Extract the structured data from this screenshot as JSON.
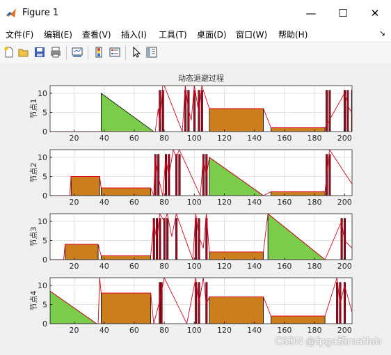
{
  "window": {
    "title": "Figure 1",
    "minimize": "—",
    "maximize": "☐",
    "close": "✕"
  },
  "menu": {
    "items": [
      "文件(F)",
      "编辑(E)",
      "查看(V)",
      "插入(I)",
      "工具(T)",
      "桌面(D)",
      "窗口(W)",
      "帮助(H)"
    ],
    "overflow": "↘"
  },
  "toolbar": {
    "buttons": [
      "new-figure-icon",
      "open-file-icon",
      "save-icon",
      "print-icon",
      "link-plot-icon",
      "insert-colorbar-icon",
      "insert-legend-icon",
      "edit-plot-icon",
      "property-inspector-icon"
    ]
  },
  "figure_title": "动态退避过程",
  "watermark": "CSDN @fpga和matlab",
  "colors": {
    "fill_triangle": "#7ccc4c",
    "fill_block": "#cc7e1c",
    "line": "#d8001c",
    "burst": "#b40018"
  },
  "chart_data": [
    {
      "type": "area",
      "ylabel": "节点1",
      "xlim": [
        4,
        205
      ],
      "ylim": [
        0,
        12
      ],
      "xticks": [
        20,
        40,
        60,
        80,
        100,
        120,
        140,
        160,
        180,
        200
      ],
      "yticks": [
        0,
        5,
        10
      ],
      "triangles": [
        {
          "x0": 38,
          "x1": 73,
          "y": 10
        }
      ],
      "blocks": [
        {
          "x0": 110,
          "x1": 146,
          "y": 6
        },
        {
          "x0": 151,
          "x1": 187,
          "y": 1
        }
      ],
      "bursts": [
        77,
        79,
        94,
        96,
        100,
        103,
        105,
        188,
        190,
        200,
        202,
        205
      ],
      "line": [
        [
          4,
          0
        ],
        [
          38,
          0
        ],
        [
          73,
          0
        ],
        [
          74,
          0
        ],
        [
          76,
          6
        ],
        [
          77,
          2
        ],
        [
          79,
          12
        ],
        [
          80,
          12
        ],
        [
          92,
          0
        ],
        [
          94,
          12
        ],
        [
          96,
          6
        ],
        [
          98,
          3
        ],
        [
          100,
          12
        ],
        [
          103,
          5
        ],
        [
          105,
          12
        ],
        [
          110,
          6
        ],
        [
          146,
          6
        ],
        [
          151,
          1
        ],
        [
          187,
          1
        ],
        [
          200,
          10
        ],
        [
          203,
          6
        ],
        [
          205,
          5
        ]
      ]
    },
    {
      "type": "area",
      "ylabel": "节点2",
      "xlim": [
        4,
        205
      ],
      "ylim": [
        0,
        12
      ],
      "xticks": [
        20,
        40,
        60,
        80,
        100,
        120,
        140,
        160,
        180,
        200
      ],
      "yticks": [
        0,
        5,
        10
      ],
      "triangles": [
        {
          "x0": 110,
          "x1": 146,
          "y": 10
        }
      ],
      "blocks": [
        {
          "x0": 18,
          "x1": 37,
          "y": 5
        },
        {
          "x0": 38,
          "x1": 71,
          "y": 2
        },
        {
          "x0": 151,
          "x1": 187,
          "y": 1
        }
      ],
      "bursts": [
        74,
        76,
        81,
        83,
        88,
        90,
        106,
        108,
        188,
        190
      ],
      "line": [
        [
          4,
          0
        ],
        [
          17,
          0
        ],
        [
          18,
          5
        ],
        [
          37,
          5
        ],
        [
          38,
          2
        ],
        [
          71,
          2
        ],
        [
          73,
          0
        ],
        [
          74,
          10
        ],
        [
          76,
          5
        ],
        [
          79,
          0
        ],
        [
          81,
          10
        ],
        [
          83,
          5
        ],
        [
          86,
          12
        ],
        [
          88,
          10
        ],
        [
          90,
          12
        ],
        [
          104,
          0
        ],
        [
          106,
          10
        ],
        [
          108,
          5
        ],
        [
          110,
          10
        ],
        [
          146,
          0
        ],
        [
          151,
          1
        ],
        [
          187,
          1
        ],
        [
          190,
          12
        ],
        [
          205,
          3
        ]
      ]
    },
    {
      "type": "area",
      "ylabel": "节点3",
      "xlim": [
        4,
        205
      ],
      "ylim": [
        0,
        12
      ],
      "xticks": [
        20,
        40,
        60,
        80,
        100,
        120,
        140,
        160,
        180,
        200
      ],
      "yticks": [
        0,
        5,
        10
      ],
      "triangles": [
        {
          "x0": 149,
          "x1": 187,
          "y": 12
        }
      ],
      "blocks": [
        {
          "x0": 14,
          "x1": 36,
          "y": 4
        },
        {
          "x0": 38,
          "x1": 71,
          "y": 1
        },
        {
          "x0": 110,
          "x1": 146,
          "y": 2
        }
      ],
      "bursts": [
        73,
        75,
        77,
        80,
        82,
        88,
        101,
        103,
        108,
        198,
        200
      ],
      "line": [
        [
          4,
          0
        ],
        [
          13,
          0
        ],
        [
          14,
          4
        ],
        [
          36,
          4
        ],
        [
          38,
          1
        ],
        [
          71,
          1
        ],
        [
          73,
          10
        ],
        [
          75,
          5
        ],
        [
          77,
          12
        ],
        [
          80,
          10
        ],
        [
          82,
          12
        ],
        [
          85,
          6
        ],
        [
          88,
          12
        ],
        [
          99,
          0
        ],
        [
          101,
          12
        ],
        [
          103,
          6
        ],
        [
          106,
          3
        ],
        [
          108,
          12
        ],
        [
          110,
          2
        ],
        [
          146,
          2
        ],
        [
          149,
          12
        ],
        [
          187,
          0
        ],
        [
          198,
          10
        ],
        [
          200,
          5
        ],
        [
          205,
          3
        ]
      ]
    },
    {
      "type": "area",
      "ylabel": "节点4",
      "xlim": [
        4,
        205
      ],
      "ylim": [
        0,
        12
      ],
      "xticks": [
        20,
        40,
        60,
        80,
        100,
        120,
        140,
        160,
        180,
        200
      ],
      "yticks": [
        0,
        5,
        10
      ],
      "triangles": [
        {
          "x0": 4,
          "x1": 35,
          "y": 8.5
        }
      ],
      "blocks": [
        {
          "x0": 38,
          "x1": 71,
          "y": 8
        },
        {
          "x0": 110,
          "x1": 146,
          "y": 7
        },
        {
          "x0": 151,
          "x1": 187,
          "y": 2
        }
      ],
      "bursts": [
        77,
        78,
        101,
        103,
        108,
        195,
        197,
        200
      ],
      "line": [
        [
          4,
          8.5
        ],
        [
          35,
          0
        ],
        [
          36,
          0
        ],
        [
          37,
          12
        ],
        [
          38,
          8
        ],
        [
          71,
          8
        ],
        [
          73,
          0
        ],
        [
          75,
          3
        ],
        [
          77,
          6
        ],
        [
          80,
          12
        ],
        [
          95,
          0
        ],
        [
          101,
          12
        ],
        [
          103,
          5
        ],
        [
          106,
          12
        ],
        [
          108,
          5
        ],
        [
          110,
          7
        ],
        [
          146,
          7
        ],
        [
          151,
          2
        ],
        [
          187,
          2
        ],
        [
          195,
          12
        ],
        [
          197,
          5
        ],
        [
          200,
          10
        ],
        [
          205,
          3
        ]
      ]
    }
  ]
}
